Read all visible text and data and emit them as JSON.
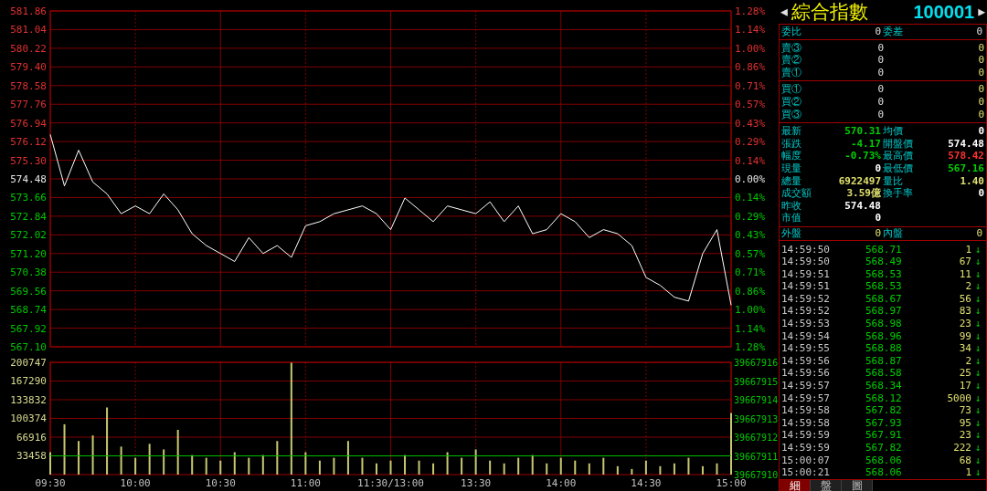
{
  "price_chart": {
    "chart_data": {
      "type": "line",
      "grid": true,
      "categories": [
        null,
        null,
        null,
        null,
        null,
        null,
        null,
        null,
        null,
        null,
        null,
        null,
        null,
        null,
        null,
        null,
        null,
        null,
        null,
        null,
        null,
        null,
        null,
        null,
        null,
        null,
        null,
        null,
        null,
        null,
        null,
        null,
        null,
        null,
        null,
        null,
        null,
        null,
        null,
        null,
        null,
        null,
        null,
        null,
        null,
        null,
        null,
        null,
        null
      ],
      "series": [
        {
          "color": "#ffffff",
          "values": [
            576.43,
            574.17,
            575.74,
            574.34,
            573.82,
            572.95,
            573.29,
            572.95,
            573.82,
            573.12,
            572.07,
            571.55,
            571.2,
            570.85,
            571.9,
            571.2,
            571.55,
            571.03,
            572.42,
            572.6,
            572.95,
            573.12,
            573.29,
            572.95,
            572.25,
            573.64,
            573.12,
            572.6,
            573.29,
            573.12,
            572.95,
            573.47,
            572.6,
            573.29,
            572.07,
            572.25,
            572.95,
            572.6,
            571.9,
            572.25,
            572.07,
            571.55,
            570.15,
            569.8,
            569.28,
            569.11,
            571.2,
            572.25,
            568.93
          ]
        }
      ],
      "ylim": [
        567.1,
        581.86
      ],
      "yticks": [
        {
          "value": 581.86,
          "label": "581.86"
        },
        {
          "value": 581.04,
          "label": "581.04"
        },
        {
          "value": 580.22,
          "label": "580.22"
        },
        {
          "value": 579.4,
          "label": "579.40"
        },
        {
          "value": 578.58,
          "label": "578.58"
        },
        {
          "value": 577.76,
          "label": "577.76"
        },
        {
          "value": 576.94,
          "label": "576.94"
        },
        {
          "value": 576.12,
          "label": "576.12"
        },
        {
          "value": 575.3,
          "label": "575.30"
        },
        {
          "value": 574.48,
          "label": "574.48"
        },
        {
          "value": 573.66,
          "label": "573.66"
        },
        {
          "value": 572.84,
          "label": "572.84"
        },
        {
          "value": 572.02,
          "label": "572.02"
        },
        {
          "value": 571.2,
          "label": "571.20"
        },
        {
          "value": 570.38,
          "label": "570.38"
        },
        {
          "value": 569.56,
          "label": "569.56"
        },
        {
          "value": 568.74,
          "label": "568.74"
        },
        {
          "value": 567.92,
          "label": "567.92"
        },
        {
          "value": 567.1,
          "label": "567.10"
        }
      ]
    },
    "percent_ticks": [
      "1.28%",
      "1.14%",
      "1.00%",
      "0.86%",
      "0.71%",
      "0.57%",
      "0.43%",
      "0.29%",
      "0.14%",
      "0.00%",
      "0.14%",
      "0.29%",
      "0.43%",
      "0.57%",
      "0.71%",
      "0.86%",
      "1.00%",
      "1.14%",
      "1.28%"
    ]
  },
  "volume_chart": {
    "chart_data": {
      "type": "bar",
      "grid": true,
      "ref_lines": [
        {
          "axis": "y",
          "value": 33458,
          "color": "#00c000"
        }
      ],
      "categories": [
        "09:30",
        null,
        null,
        null,
        null,
        null,
        "10:00",
        null,
        null,
        null,
        null,
        null,
        "10:30",
        null,
        null,
        null,
        null,
        null,
        "11:00",
        null,
        null,
        null,
        null,
        null,
        "11:30/13:00",
        null,
        null,
        null,
        null,
        null,
        "13:30",
        null,
        null,
        null,
        null,
        null,
        "14:00",
        null,
        null,
        null,
        null,
        null,
        "14:30",
        null,
        null,
        null,
        null,
        null,
        "15:00"
      ],
      "series": [
        {
          "color": "#c8c870",
          "values": [
            40000,
            90000,
            60000,
            70000,
            120000,
            50000,
            30000,
            55000,
            45000,
            80000,
            35000,
            30000,
            25000,
            40000,
            30000,
            35000,
            60000,
            200000,
            40000,
            25000,
            30000,
            60000,
            30000,
            20000,
            25000,
            35000,
            25000,
            20000,
            40000,
            30000,
            45000,
            25000,
            20000,
            30000,
            35000,
            20000,
            30000,
            25000,
            20000,
            30000,
            15000,
            10000,
            25000,
            15000,
            20000,
            30000,
            15000,
            20000,
            110000
          ]
        }
      ],
      "ylim": [
        0,
        200747
      ],
      "yticks": [
        {
          "value": 200747,
          "label": "200747"
        },
        {
          "value": 167290,
          "label": "167290"
        },
        {
          "value": 133832,
          "label": "133832"
        },
        {
          "value": 100374,
          "label": "100374"
        },
        {
          "value": 66916,
          "label": "66916"
        },
        {
          "value": 33458,
          "label": "33458"
        }
      ]
    },
    "right_ticks": [
      "39667916",
      "39667915",
      "39667914",
      "39667913",
      "39667912",
      "39667911",
      "39667910"
    ]
  },
  "quote_panel": {
    "prev_arrow": "◀",
    "name": "綜合指數",
    "code": "100001",
    "next_arrow": "▶",
    "ratio": [
      {
        "label": "委比",
        "value": "0"
      },
      {
        "label": "委差",
        "value": "0"
      }
    ],
    "asks": [
      {
        "label": "賣③",
        "price": "0",
        "volume": "0"
      },
      {
        "label": "賣②",
        "price": "0",
        "volume": "0"
      },
      {
        "label": "賣①",
        "price": "0",
        "volume": "0"
      }
    ],
    "bids": [
      {
        "label": "買①",
        "price": "0",
        "volume": "0"
      },
      {
        "label": "買②",
        "price": "0",
        "volume": "0"
      },
      {
        "label": "買③",
        "price": "0",
        "volume": "0"
      }
    ],
    "stats": [
      {
        "cells": [
          {
            "label": "最新",
            "value": "570.31",
            "color": "#00d000"
          },
          {
            "label": "均價",
            "value": "0",
            "color": "#ffffff"
          }
        ]
      },
      {
        "cells": [
          {
            "label": "張跌",
            "value": "-4.17",
            "color": "#00d000"
          },
          {
            "label": "開盤價",
            "value": "574.48",
            "color": "#ffffff"
          }
        ]
      },
      {
        "cells": [
          {
            "label": "幅度",
            "value": "-0.73%",
            "color": "#00d000"
          },
          {
            "label": "最高價",
            "value": "578.42",
            "color": "#ff3030"
          }
        ]
      },
      {
        "cells": [
          {
            "label": "現量",
            "value": "0",
            "color": "#ffffff"
          },
          {
            "label": "最低價",
            "value": "567.16",
            "color": "#00d000"
          }
        ]
      },
      {
        "cells": [
          {
            "label": "總量",
            "value": "6922497",
            "color": "#e0e070"
          },
          {
            "label": "量比",
            "value": "1.40",
            "color": "#e0e070"
          }
        ]
      },
      {
        "cells": [
          {
            "label": "成交額",
            "value": "3.59億",
            "color": "#e0e070"
          },
          {
            "label": "換手率",
            "value": "0",
            "color": "#ffffff"
          }
        ]
      },
      {
        "cells": [
          {
            "label": "昨收",
            "value": "574.48",
            "color": "#ffffff"
          }
        ]
      },
      {
        "cells": [
          {
            "label": "市值",
            "value": "0",
            "color": "#ffffff"
          }
        ]
      }
    ],
    "outer_inner": [
      {
        "label": "外盤",
        "value": "0"
      },
      {
        "label": "內盤",
        "value": "0"
      }
    ],
    "trades": [
      {
        "time": "14:59:50",
        "price": "568.71",
        "volume": "1",
        "arrow": "↓"
      },
      {
        "time": "14:59:50",
        "price": "568.49",
        "volume": "67",
        "arrow": "↓"
      },
      {
        "time": "14:59:51",
        "price": "568.53",
        "volume": "11",
        "arrow": "↓"
      },
      {
        "time": "14:59:51",
        "price": "568.53",
        "volume": "2",
        "arrow": "↓"
      },
      {
        "time": "14:59:52",
        "price": "568.67",
        "volume": "56",
        "arrow": "↓"
      },
      {
        "time": "14:59:52",
        "price": "568.97",
        "volume": "83",
        "arrow": "↓"
      },
      {
        "time": "14:59:53",
        "price": "568.98",
        "volume": "23",
        "arrow": "↓"
      },
      {
        "time": "14:59:54",
        "price": "568.96",
        "volume": "99",
        "arrow": "↓"
      },
      {
        "time": "14:59:55",
        "price": "568.88",
        "volume": "34",
        "arrow": "↓"
      },
      {
        "time": "14:59:56",
        "price": "568.87",
        "volume": "2",
        "arrow": "↓"
      },
      {
        "time": "14:59:56",
        "price": "568.58",
        "volume": "25",
        "arrow": "↓"
      },
      {
        "time": "14:59:57",
        "price": "568.34",
        "volume": "17",
        "arrow": "↓"
      },
      {
        "time": "14:59:57",
        "price": "568.12",
        "volume": "5000",
        "arrow": "↓"
      },
      {
        "time": "14:59:58",
        "price": "567.82",
        "volume": "73",
        "arrow": "↓"
      },
      {
        "time": "14:59:58",
        "price": "567.93",
        "volume": "95",
        "arrow": "↓"
      },
      {
        "time": "14:59:59",
        "price": "567.91",
        "volume": "23",
        "arrow": "↓"
      },
      {
        "time": "14:59:59",
        "price": "567.82",
        "volume": "222",
        "arrow": "↓"
      },
      {
        "time": "15:00:07",
        "price": "568.06",
        "volume": "68",
        "arrow": "↓"
      },
      {
        "time": "15:00:21",
        "price": "568.06",
        "volume": "1",
        "arrow": "↓"
      }
    ],
    "tabs": [
      {
        "label": "細",
        "selected": true
      },
      {
        "label": "盤",
        "selected": false
      },
      {
        "label": "圖",
        "selected": false
      }
    ]
  }
}
